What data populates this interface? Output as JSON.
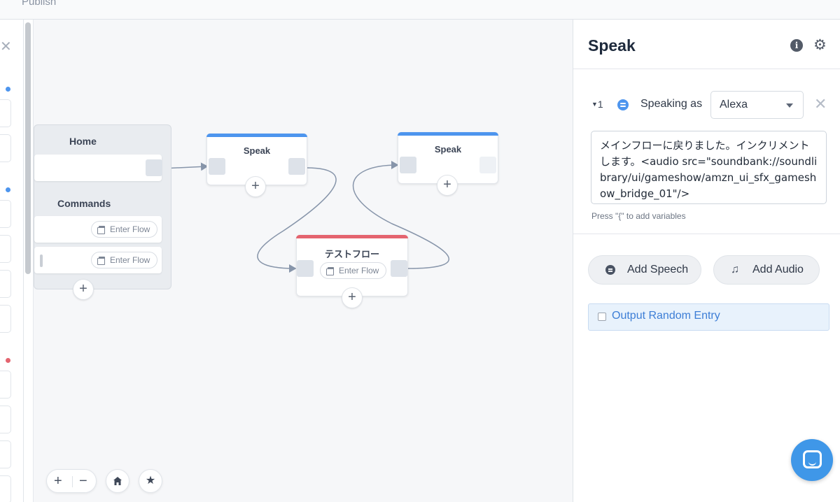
{
  "topbar": {
    "publish_label": "Publish"
  },
  "canvas": {
    "home_group": {
      "title": "Home",
      "commands_title": "Commands",
      "command_rows": [
        {
          "button_label": "Enter Flow"
        },
        {
          "button_label": "Enter Flow"
        }
      ]
    },
    "nodes": [
      {
        "title": "Speak",
        "color": "#4d95ee"
      },
      {
        "title": "Speak",
        "color": "#4d95ee"
      },
      {
        "title": "テストフロー",
        "color": "#e4646f",
        "button_label": "Enter Flow"
      }
    ],
    "tools": {
      "zoom_in": "+",
      "zoom_out": "−",
      "home_icon": "home-icon",
      "star_icon": "star-icon"
    }
  },
  "panel": {
    "title": "Speak",
    "entry": {
      "index": "1",
      "speaking_as_label": "Speaking as",
      "voice": "Alexa",
      "text": "メインフローに戻りました。インクリメントします。<audio src=\"soundbank://soundlibrary/ui/gameshow/amzn_ui_sfx_gameshow_bridge_01\"/>"
    },
    "hint": "Press \"{\" to add variables",
    "add_speech_label": "Add Speech",
    "add_audio_label": "Add Audio",
    "random_entry_label": "Output Random Entry"
  },
  "colors": {
    "accent_blue": "#4d95ee",
    "accent_red": "#e4646f",
    "launcher": "#3f97e8"
  }
}
